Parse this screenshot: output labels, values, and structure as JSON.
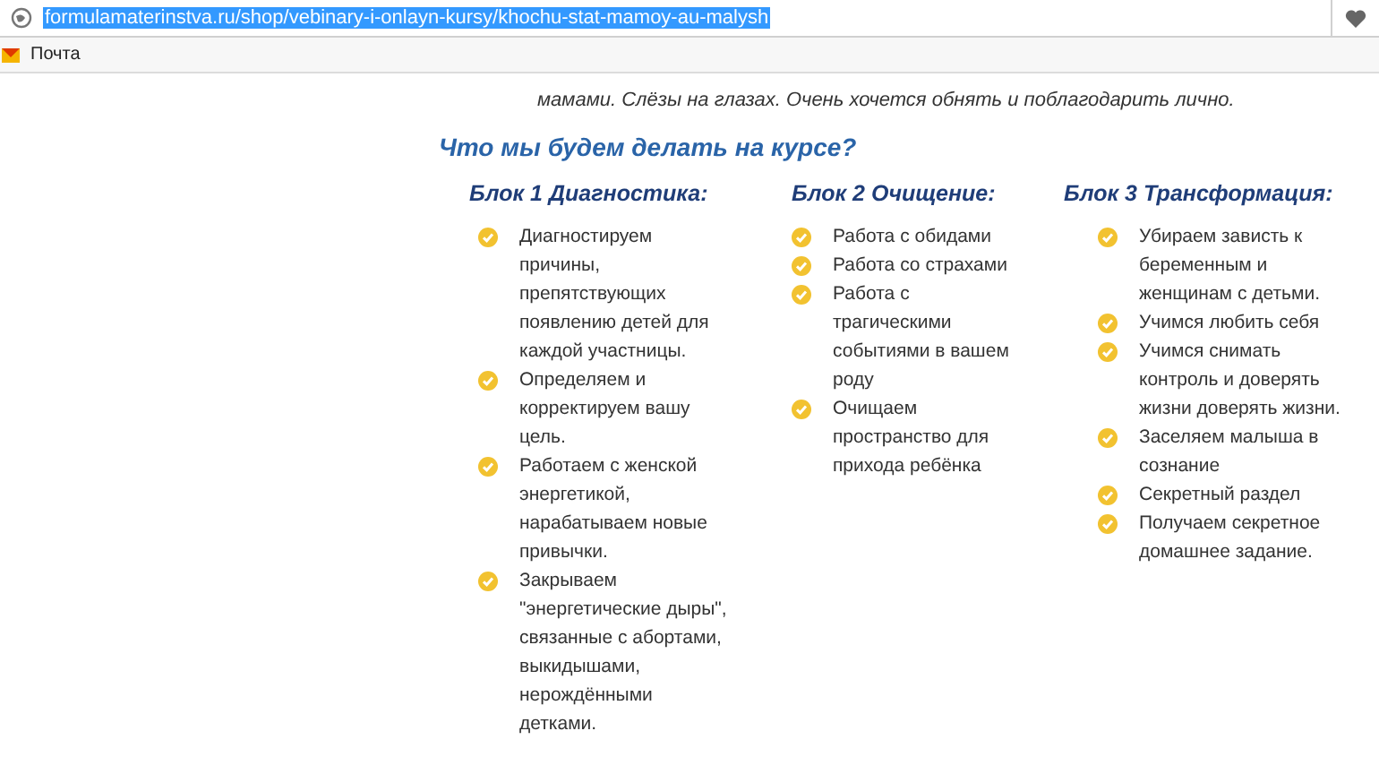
{
  "address_bar": {
    "url": "formulamaterinstva.ru/shop/vebinary-i-onlayn-kursy/khochu-stat-mamoy-au-malysh"
  },
  "bookmarks": [
    "Почта"
  ],
  "intro_text": "мамами. Слёзы на глазах. Очень хочется обнять и поблагодарить лично.",
  "section_title": "Что мы будем делать на курсе?",
  "blocks": [
    {
      "title": "Блок 1 Диагностика:",
      "items": [
        "Диагностируем причины, препятствующих появлению детей для каждой участницы.",
        "Определяем и корректируем вашу цель.",
        "Работаем с женской энергетикой, нарабатываем новые привычки.",
        "Закрываем \"энергетические дыры\", связанные с абортами, выкидышами, нерождёнными детками."
      ]
    },
    {
      "title": "Блок 2 Очищение:",
      "items": [
        "Работа с обидами",
        "Работа со страхами",
        "Работа с трагическими событиями в вашем роду",
        "Очищаем пространство для прихода ребёнка"
      ]
    },
    {
      "title": "Блок 3 Трансформация:",
      "items": [
        "Убираем зависть к беременным и женщинам с детьми.",
        "Учимся любить себя",
        "Учимся снимать контроль и доверять жизни доверять жизни.",
        "Заселяем малыша в сознание",
        "Секретный раздел",
        "Получаем секретное домашнее задание."
      ]
    }
  ]
}
